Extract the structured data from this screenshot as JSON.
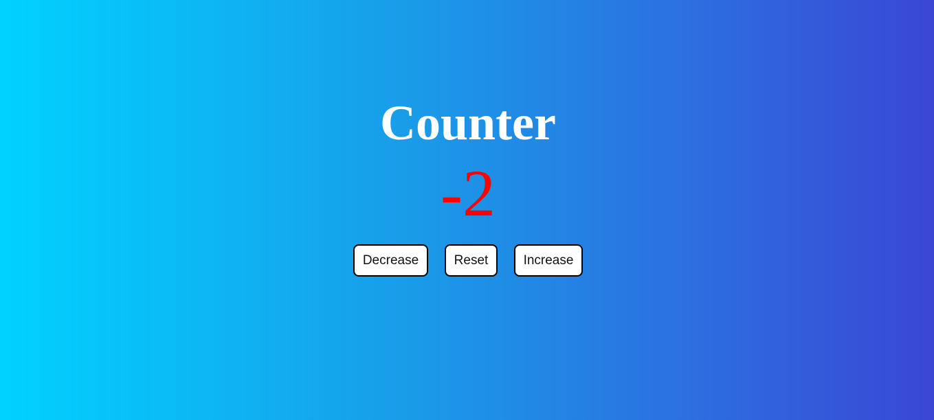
{
  "counter": {
    "title": "Counter",
    "value": "-2",
    "value_color": "#ff0000"
  },
  "buttons": {
    "decrease_label": "Decrease",
    "reset_label": "Reset",
    "increase_label": "Increase"
  },
  "theme": {
    "gradient_start": "#00d2ff",
    "gradient_end": "#3a47d5",
    "title_color": "#ffffff",
    "button_background": "#ffffff",
    "button_border": "#000000"
  }
}
